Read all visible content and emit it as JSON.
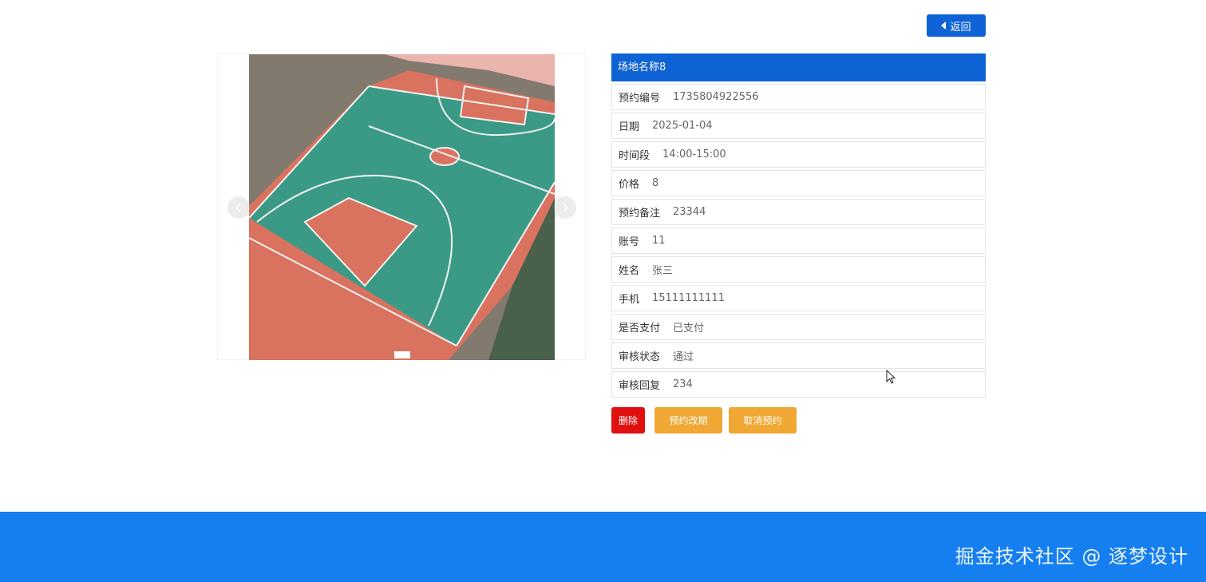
{
  "header": {
    "back_label": "返回"
  },
  "carousel": {
    "image_alt": "basketball court",
    "colors": {
      "court_red": "#d9725e",
      "court_green": "#3a9a86",
      "line": "#f2f2f2"
    }
  },
  "detail": {
    "title": "场地名称8",
    "rows": [
      {
        "label": "预约编号",
        "value": "1735804922556"
      },
      {
        "label": "日期",
        "value": "2025-01-04"
      },
      {
        "label": "时间段",
        "value": "14:00-15:00"
      },
      {
        "label": "价格",
        "value": "8"
      },
      {
        "label": "预约备注",
        "value": "23344"
      },
      {
        "label": "账号",
        "value": "11"
      },
      {
        "label": "姓名",
        "value": "张三"
      },
      {
        "label": "手机",
        "value": "15111111111"
      },
      {
        "label": "是否支付",
        "value": "已支付"
      },
      {
        "label": "审核状态",
        "value": "通过"
      },
      {
        "label": "审核回复",
        "value": "234"
      }
    ]
  },
  "actions": {
    "delete_label": "删除",
    "change_label": "预约改期",
    "cancel_label": "取消预约"
  },
  "footer": {
    "watermark": "掘金技术社区 @ 逐梦设计"
  },
  "colors": {
    "primary": "#0d62d4",
    "danger": "#e0110f",
    "warning": "#f0a733",
    "footer": "#157ff0"
  }
}
